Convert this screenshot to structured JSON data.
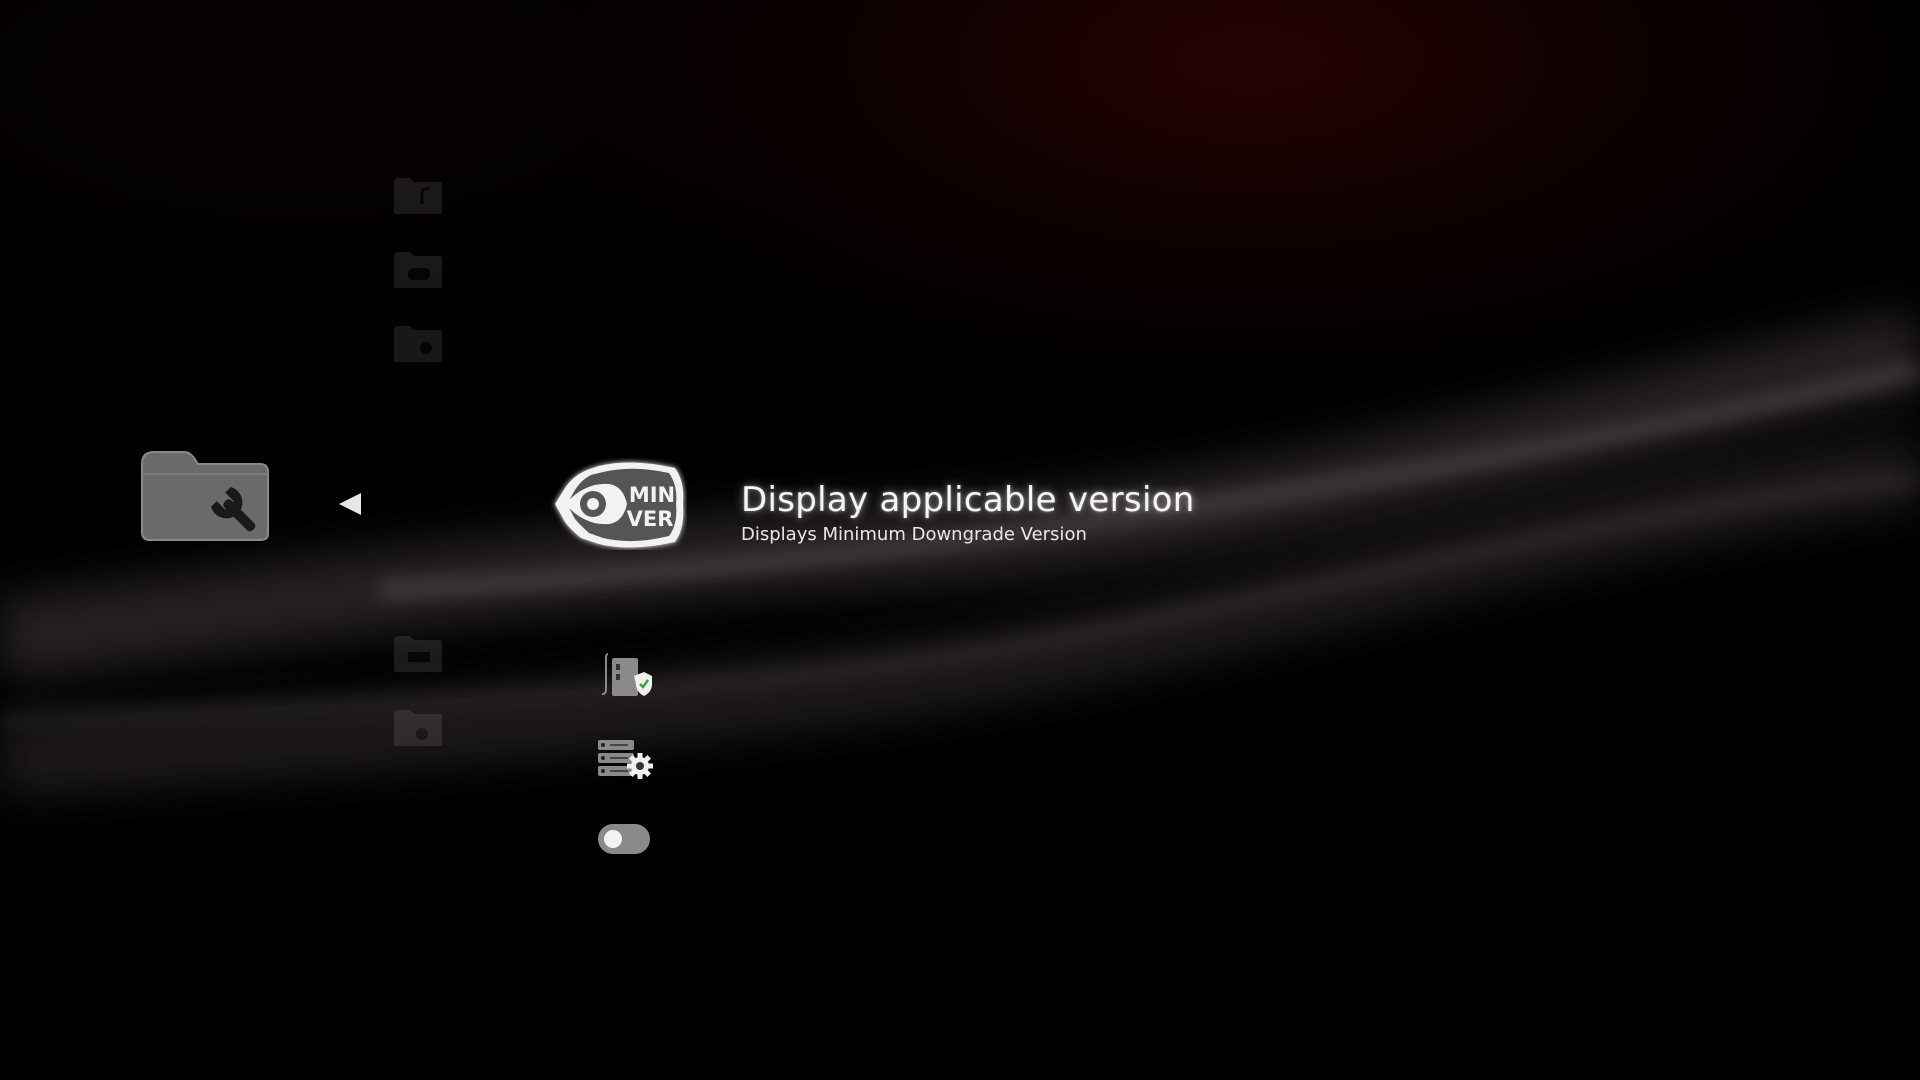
{
  "category": {
    "icon": "folder-wrench-icon",
    "arrow": "left-arrow-icon"
  },
  "faded_categories": [
    {
      "icon": "folder-music-icon"
    },
    {
      "icon": "folder-game-icon"
    },
    {
      "icon": "folder-camera-icon"
    },
    {
      "icon": "folder-tv-icon"
    },
    {
      "icon": "folder-network-icon"
    }
  ],
  "selected_item": {
    "icon": "min-ver-eye-icon",
    "badge_line1": "MIN",
    "badge_line2": "VER",
    "title": "Display applicable version",
    "description": "Displays Minimum Downgrade Version"
  },
  "items": [
    {
      "icon": "security-phone-shield-icon"
    },
    {
      "icon": "server-settings-icon"
    },
    {
      "icon": "toggle-switch-icon",
      "state": "off"
    }
  ],
  "colors": {
    "background": "#000000",
    "accent_red": "#460505",
    "icon_gray": "#6f6f6f",
    "text": "#f5f5f5"
  }
}
